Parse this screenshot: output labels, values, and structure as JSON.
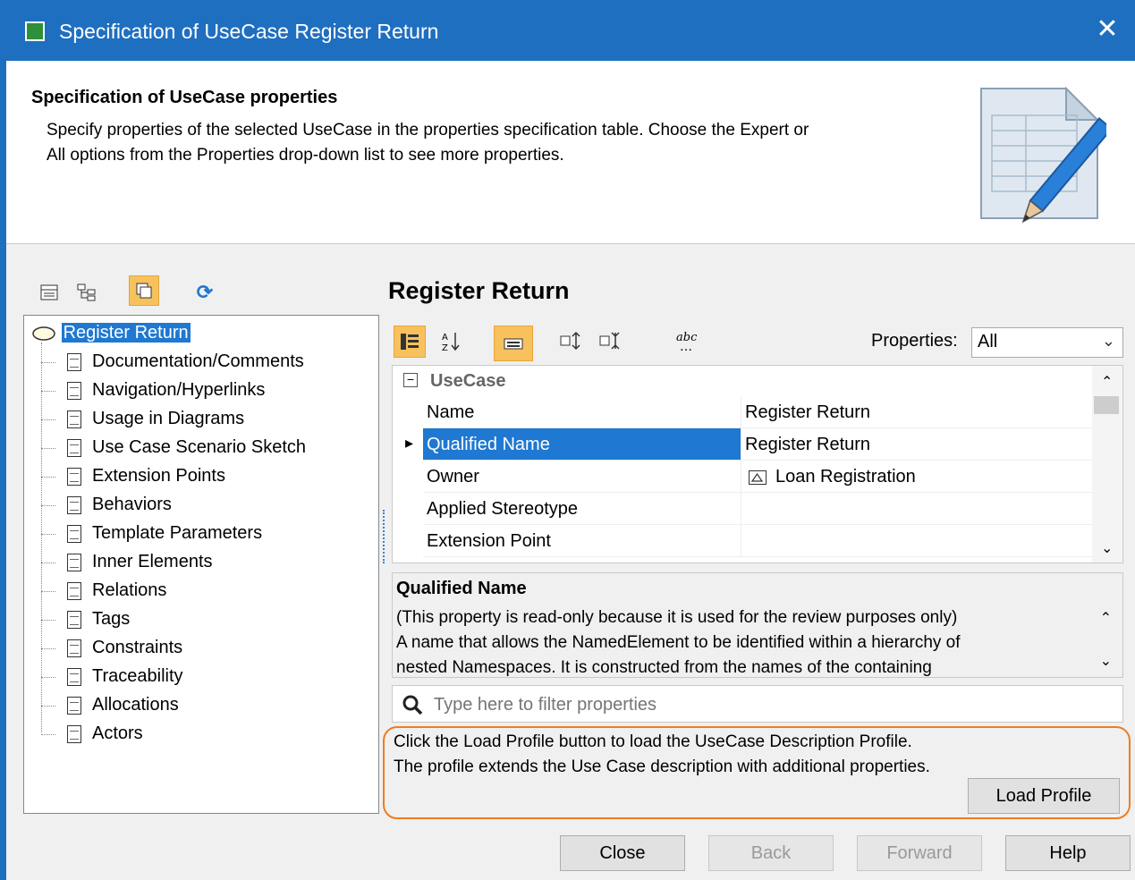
{
  "window": {
    "title": "Specification of UseCase Register Return"
  },
  "header": {
    "heading": "Specification of UseCase properties",
    "description_line1": "Specify properties of the selected UseCase in the properties specification table. Choose the Expert or",
    "description_line2": "All options from the Properties drop-down list to see more properties."
  },
  "tree": {
    "root": "Register Return",
    "items": [
      "Documentation/Comments",
      "Navigation/Hyperlinks",
      "Usage in Diagrams",
      "Use Case Scenario Sketch",
      "Extension Points",
      "Behaviors",
      "Template Parameters",
      "Inner Elements",
      "Relations",
      "Tags",
      "Constraints",
      "Traceability",
      "Allocations",
      "Actors"
    ]
  },
  "props": {
    "title": "Register Return",
    "properties_label": "Properties:",
    "properties_value": "All",
    "group": "UseCase",
    "rows": [
      {
        "name": "Name",
        "value": "Register Return"
      },
      {
        "name": "Qualified Name",
        "value": "Register Return"
      },
      {
        "name": "Owner",
        "value": "Loan Registration"
      },
      {
        "name": "Applied Stereotype",
        "value": ""
      },
      {
        "name": "Extension Point",
        "value": ""
      }
    ]
  },
  "description": {
    "title": "Qualified Name",
    "line1": "(This property is read-only because it is used for the review purposes only)",
    "line2": "A name that allows the NamedElement to be identified within a hierarchy of",
    "line3": "nested Namespaces. It is constructed from the names of the containing"
  },
  "filter": {
    "placeholder": "Type here to filter properties"
  },
  "profile": {
    "line1": "Click the Load Profile button to load the UseCase Description Profile.",
    "line2": "The profile extends the Use Case description with additional properties.",
    "button": "Load Profile"
  },
  "buttons": {
    "close": "Close",
    "back": "Back",
    "forward": "Forward",
    "help": "Help"
  },
  "colors": {
    "titlebar": "#1f6fc0",
    "selection": "#1f78d1",
    "highlight_border": "#f07c20",
    "toolbar_active": "#f7c25e"
  }
}
